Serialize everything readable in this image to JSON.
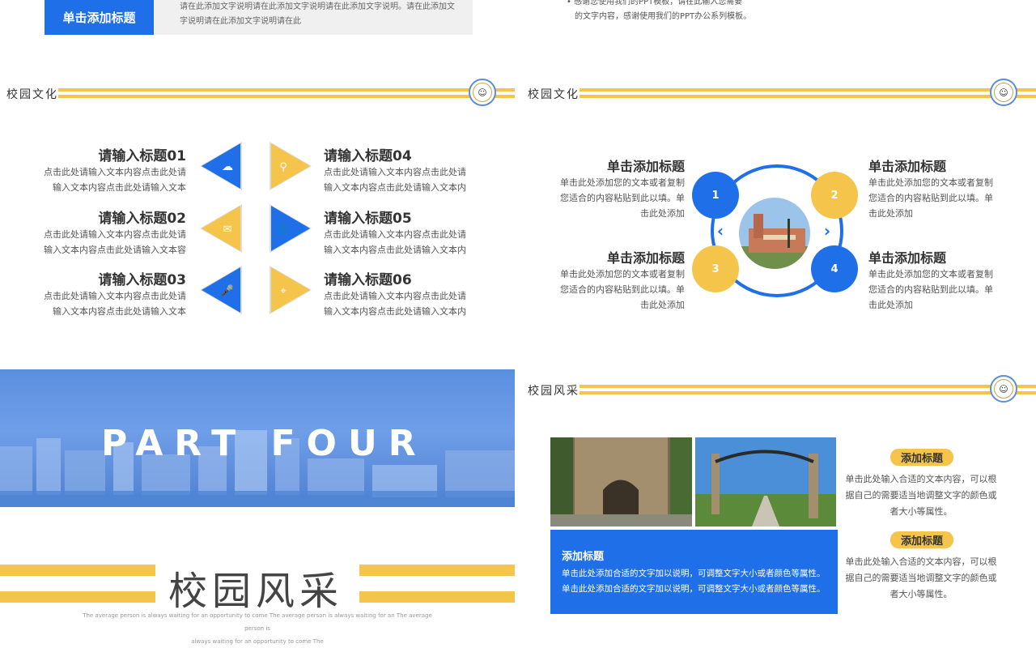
{
  "top": {
    "tag_label": "单击添加标题",
    "gray_text": "请在此添加文字说明请在此添加文字说明请在此添加文字说明。请在此添加文字说明请在此添加文字说明请在此",
    "right_line1": "• 感谢您使用我们的PPT模板，请在此输入您需要",
    "right_line2": "的文字内容，感谢使用我们的PPT办公系列模板。"
  },
  "panel1": {
    "section_title": "校园文化",
    "items_left": [
      {
        "title": "请输入标题01",
        "desc1": "点击此处请输入文本内容点击此处请",
        "desc2": "输入文本内容点击此处请输入文本",
        "icon": "cloud-icon"
      },
      {
        "title": "请输入标题02",
        "desc1": "点击此处请输入文本内容点击此处请",
        "desc2": "输入文本内容点击此处请输入文本容",
        "icon": "chat-icon"
      },
      {
        "title": "请输入标题03",
        "desc1": "点击此处请输入文本内容点击此处请",
        "desc2": "输入文本内容点击此处请输入文本",
        "icon": "mic-icon"
      }
    ],
    "items_right": [
      {
        "title": "请输入标题04",
        "desc1": "点击此处请输入文本内容点击此处请",
        "desc2": "输入文本内容点击此处请输入文本内",
        "icon": "search-icon"
      },
      {
        "title": "请输入标题05",
        "desc1": "点击此处请输入文本内容点击此处请",
        "desc2": "输入文本内容点击此处请输入文本内",
        "icon": "user-icon"
      },
      {
        "title": "请输入标题06",
        "desc1": "点击此处请输入文本内容点击此处请",
        "desc2": "输入文本内容点击此处请输入文本内",
        "icon": "location-icon"
      }
    ]
  },
  "panel2": {
    "section_title": "校园文化",
    "blocks": [
      {
        "title": "单击添加标题",
        "line1": "单击此处添加您的文本或者复制",
        "line2": "您适合的内容粘贴到此以填。单",
        "line3": "击此处添加",
        "num": "1"
      },
      {
        "title": "单击添加标题",
        "line1": "单击此处添加您的文本或者复制",
        "line2": "您适合的内容粘贴到此以填。单",
        "line3": "击此处添加",
        "num": "2"
      },
      {
        "title": "单击添加标题",
        "line1": "单击此处添加您的文本或者复制",
        "line2": "您适合的内容粘贴到此以填。单",
        "line3": "击此处添加",
        "num": "3"
      },
      {
        "title": "单击添加标题",
        "line1": "单击此处添加您的文本或者复制",
        "line2": "您适合的内容粘贴到此以填。单",
        "line3": "击此处添加",
        "num": "4"
      }
    ]
  },
  "panel3": {
    "part_text": "PART FOUR",
    "title": "校园风采",
    "en_line1": "The average person is always waiting for an opportunity to come The average person is always waiting for an The average person is",
    "en_line2": "always waiting for an opportunity to come The"
  },
  "panel4": {
    "section_title": "校园风采",
    "box_title": "添加标题",
    "box_line1": "单击此处添加合适的文字加以说明，可调整文字大小或者颜色等属性。",
    "box_line2": "单击此处添加合适的文字加以说明，可调整文字大小或者颜色等属性。",
    "pill1": "添加标题",
    "desc1_l1": "单击此处输入合适的文本内容，可以根",
    "desc1_l2": "据自己的需要适当地调整文字的颜色或",
    "desc1_l3": "者大小等属性。",
    "pill2": "添加标题",
    "desc2_l1": "单击此处输入合适的文本内容，可以根",
    "desc2_l2": "据自己的需要适当地调整文字的颜色或",
    "desc2_l3": "者大小等属性。"
  },
  "colors": {
    "blue": "#1f6fe8",
    "yellow": "#f5c44a"
  }
}
